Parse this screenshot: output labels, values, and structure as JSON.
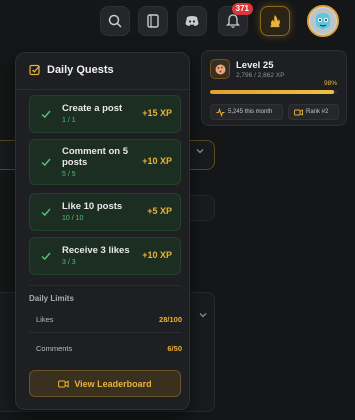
{
  "topbar": {
    "notification_count": "371",
    "icons": [
      "search-icon",
      "book-icon",
      "discord-icon",
      "bell-icon",
      "xp-flame-icon",
      "avatar"
    ]
  },
  "quests": {
    "title": "Daily Quests",
    "items": [
      {
        "name": "Create a post",
        "progress": "1 / 1",
        "xp": "+15 XP"
      },
      {
        "name": "Comment on 5 posts",
        "progress": "5 / 5",
        "xp": "+10 XP"
      },
      {
        "name": "Like 10 posts",
        "progress": "10 / 10",
        "xp": "+5 XP"
      },
      {
        "name": "Receive 3 likes",
        "progress": "3 / 3",
        "xp": "+10 XP"
      }
    ],
    "limits_title": "Daily Limits",
    "limits": [
      {
        "label": "Likes",
        "value": "28/100"
      },
      {
        "label": "Comments",
        "value": "6/50"
      }
    ],
    "leaderboard_label": "View Leaderboard"
  },
  "level": {
    "title": "Level 25",
    "xp": "2,796 / 2,862 XP",
    "percent_label": "98%",
    "progress": 0.98,
    "this_month": "5,245 this month",
    "rank": "Rank #2"
  },
  "colors": {
    "accent": "#e8b33a",
    "success": "#4fbf73",
    "badge": "#d9383a"
  }
}
